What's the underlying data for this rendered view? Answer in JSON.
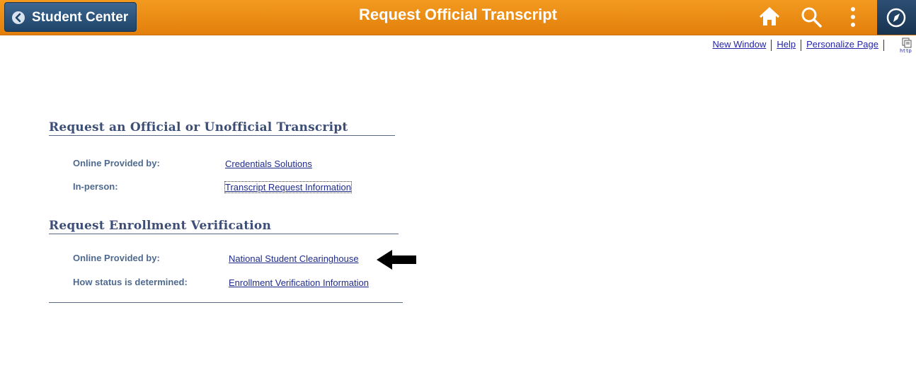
{
  "header": {
    "back_label": "Student Center",
    "title": "Request Official Transcript",
    "icons": [
      "home-icon",
      "search-icon",
      "more-vertical-icon",
      "navbar-compass-icon"
    ]
  },
  "toplinks": {
    "new_window": "New Window",
    "help": "Help",
    "personalize": "Personalize Page",
    "http_label": "http"
  },
  "transcript": {
    "title": "Request an Official or Unofficial Transcript",
    "online_label": "Online Provided by:",
    "online_link": "Credentials Solutions",
    "inperson_label": "In-person:",
    "inperson_link": "Transcript Request Information"
  },
  "enrollment": {
    "title": "Request Enrollment Verification",
    "online_label": "Online Provided by:",
    "online_link": "National Student Clearinghouse",
    "status_label": "How status is determined:",
    "status_link": "Enrollment Verification Information"
  },
  "colors": {
    "banner": "#ef8d17",
    "back_button": "#2a5580",
    "section_title": "#3d4f77",
    "label": "#4f6a8e",
    "link": "#1f2b8a"
  }
}
